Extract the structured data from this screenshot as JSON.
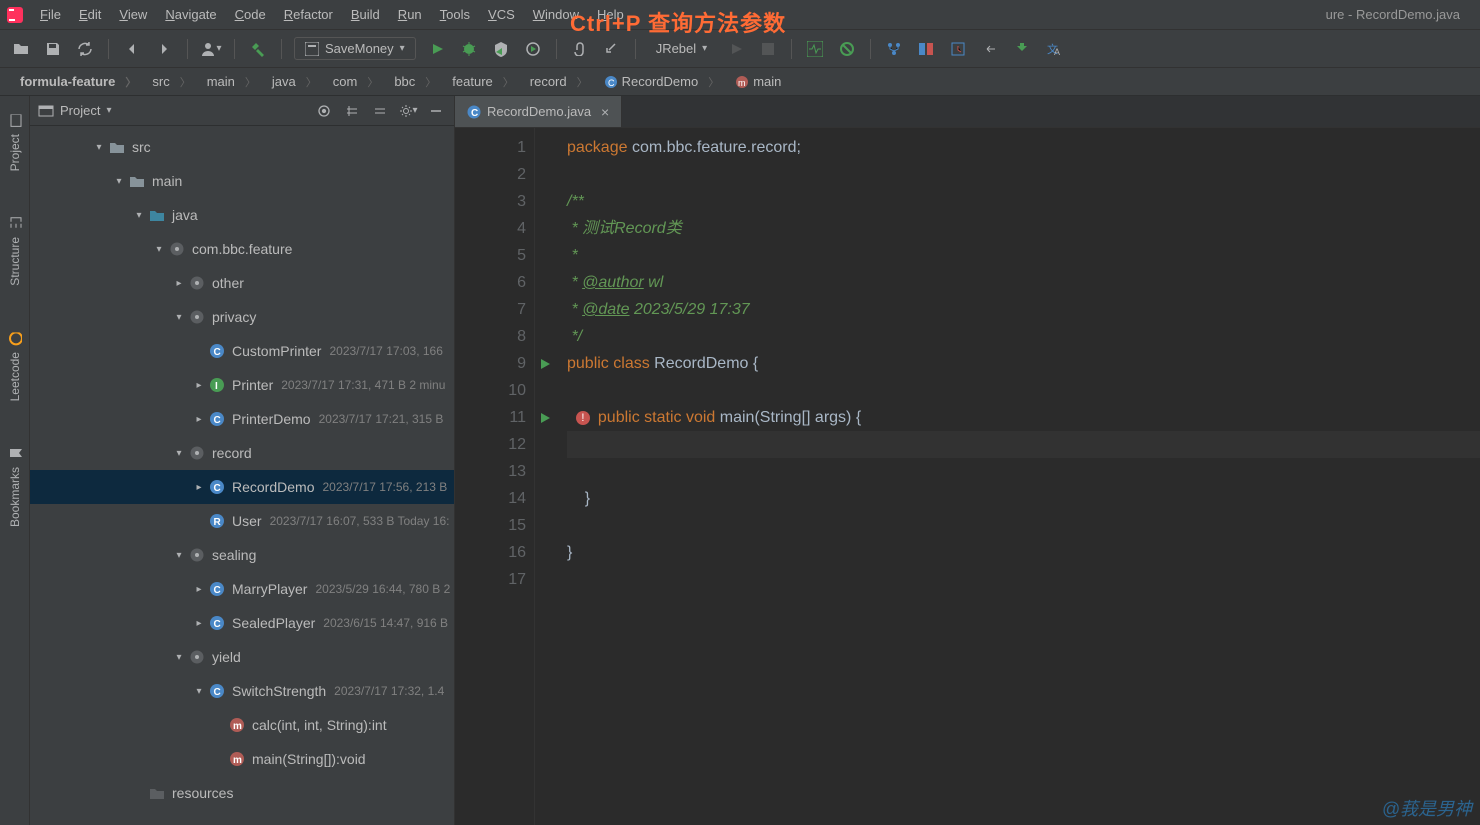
{
  "window": {
    "title": "ure - RecordDemo.java"
  },
  "overlay": {
    "text": "Ctrl+P 查询方法参数"
  },
  "watermark": "@莪是男神",
  "menu": [
    "File",
    "Edit",
    "View",
    "Navigate",
    "Code",
    "Refactor",
    "Build",
    "Run",
    "Tools",
    "VCS",
    "Window",
    "Help"
  ],
  "toolbar": {
    "run_config": "SaveMoney",
    "jrebel": "JRebel"
  },
  "breadcrumb": [
    "formula-feature",
    "src",
    "main",
    "java",
    "com",
    "bbc",
    "feature",
    "record",
    "RecordDemo",
    "main"
  ],
  "panel": {
    "title": "Project",
    "tree": [
      {
        "depth": 1,
        "arrow": "v",
        "icon": "folder",
        "label": "src",
        "meta": ""
      },
      {
        "depth": 2,
        "arrow": "v",
        "icon": "folder",
        "label": "main",
        "meta": ""
      },
      {
        "depth": 3,
        "arrow": "v",
        "icon": "folder-src",
        "label": "java",
        "meta": ""
      },
      {
        "depth": 4,
        "arrow": "v",
        "icon": "package",
        "label": "com.bbc.feature",
        "meta": ""
      },
      {
        "depth": 5,
        "arrow": ">",
        "icon": "package",
        "label": "other",
        "meta": ""
      },
      {
        "depth": 5,
        "arrow": "v",
        "icon": "package",
        "label": "privacy",
        "meta": ""
      },
      {
        "depth": 6,
        "arrow": "",
        "icon": "class",
        "label": "CustomPrinter",
        "meta": "2023/7/17 17:03, 166"
      },
      {
        "depth": 6,
        "arrow": ">",
        "icon": "interface",
        "label": "Printer",
        "meta": "2023/7/17 17:31, 471 B 2 minu"
      },
      {
        "depth": 6,
        "arrow": ">",
        "icon": "class",
        "label": "PrinterDemo",
        "meta": "2023/7/17 17:21, 315 B"
      },
      {
        "depth": 5,
        "arrow": "v",
        "icon": "package",
        "label": "record",
        "meta": ""
      },
      {
        "depth": 6,
        "arrow": ">",
        "icon": "class",
        "label": "RecordDemo",
        "meta": "2023/7/17 17:56, 213 B",
        "selected": true
      },
      {
        "depth": 6,
        "arrow": "",
        "icon": "record",
        "label": "User",
        "meta": "2023/7/17 16:07, 533 B Today 16:"
      },
      {
        "depth": 5,
        "arrow": "v",
        "icon": "package",
        "label": "sealing",
        "meta": ""
      },
      {
        "depth": 6,
        "arrow": ">",
        "icon": "class",
        "label": "MarryPlayer",
        "meta": "2023/5/29 16:44, 780 B 2"
      },
      {
        "depth": 6,
        "arrow": ">",
        "icon": "sealed",
        "label": "SealedPlayer",
        "meta": "2023/6/15 14:47, 916 B"
      },
      {
        "depth": 5,
        "arrow": "v",
        "icon": "package",
        "label": "yield",
        "meta": ""
      },
      {
        "depth": 6,
        "arrow": "v",
        "icon": "class",
        "label": "SwitchStrength",
        "meta": "2023/7/17 17:32, 1.4"
      },
      {
        "depth": 7,
        "arrow": "",
        "icon": "method",
        "label": "calc(int, int, String):int",
        "meta": ""
      },
      {
        "depth": 7,
        "arrow": "",
        "icon": "method",
        "label": "main(String[]):void",
        "meta": ""
      },
      {
        "depth": 3,
        "arrow": "",
        "icon": "folder-dim",
        "label": "resources",
        "meta": ""
      }
    ]
  },
  "tab": {
    "name": "RecordDemo.java"
  },
  "code": {
    "lines": [
      {
        "n": 1,
        "run": "",
        "html": "<span class='kw'>package</span> <span class='pkg'>com.bbc.feature.record</span><span class='sym'>;</span>"
      },
      {
        "n": 2,
        "run": "",
        "html": ""
      },
      {
        "n": 3,
        "run": "",
        "html": "<span class='doc'>/**</span>"
      },
      {
        "n": 4,
        "run": "",
        "html": "<span class='doc'> * 测试Record类</span>"
      },
      {
        "n": 5,
        "run": "",
        "html": "<span class='doc'> *</span>"
      },
      {
        "n": 6,
        "run": "",
        "html": "<span class='doc'> * <span class='doctag'>@author</span> wl</span>"
      },
      {
        "n": 7,
        "run": "",
        "html": "<span class='doc'> * <span class='doctag'>@date</span> 2023/5/29 17:37</span>"
      },
      {
        "n": 8,
        "run": "",
        "html": "<span class='doc'> */</span>"
      },
      {
        "n": 9,
        "run": "play",
        "html": "<span class='kw'>public</span> <span class='kw'>class</span> <span class='cls'>RecordDemo</span> <span class='sym'>{</span>"
      },
      {
        "n": 10,
        "run": "",
        "html": ""
      },
      {
        "n": 11,
        "run": "play",
        "html": "  <span class='warn-icon'>!</span><span class='kw'>public</span> <span class='kw'>static</span> <span class='kw'>void</span> <span class='cls'>main</span><span class='sym'>(</span>String<span class='sym'>[]</span> args<span class='sym'>)</span> <span class='sym'>{</span>"
      },
      {
        "n": 12,
        "run": "",
        "html": "",
        "current": true
      },
      {
        "n": 13,
        "run": "",
        "html": ""
      },
      {
        "n": 14,
        "run": "",
        "html": "    <span class='sym'>}</span>"
      },
      {
        "n": 15,
        "run": "",
        "html": ""
      },
      {
        "n": 16,
        "run": "",
        "html": "<span class='sym'>}</span>"
      },
      {
        "n": 17,
        "run": "",
        "html": ""
      }
    ]
  },
  "side_tabs": [
    "Project",
    "Structure",
    "Leetcode",
    "Bookmarks"
  ]
}
